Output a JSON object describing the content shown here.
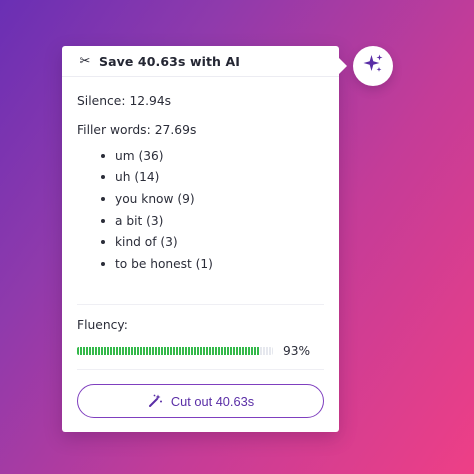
{
  "popup": {
    "title": "Save 40.63s with AI",
    "silence": {
      "label": "Silence:",
      "value": "12.94s"
    },
    "filler": {
      "label": "Filler words:",
      "value": "27.69s",
      "items": [
        {
          "text": "um (36)"
        },
        {
          "text": "uh (14)"
        },
        {
          "text": "you know (9)"
        },
        {
          "text": "a bit (3)"
        },
        {
          "text": "kind of (3)"
        },
        {
          "text": "to be honest (1)"
        }
      ]
    },
    "fluency": {
      "label": "Fluency:",
      "percent_text": "93%",
      "percent_value": 93
    },
    "cut_button_label": "Cut out 40.63s"
  },
  "icons": {
    "header": "scissors-icon",
    "cut": "magic-wand-icon",
    "ai": "sparkle-icon"
  },
  "colors": {
    "accent": "#7f3fbf",
    "progress_fill": "#34b94a",
    "background_start": "#6a2fb4",
    "background_end": "#ee3f86"
  }
}
